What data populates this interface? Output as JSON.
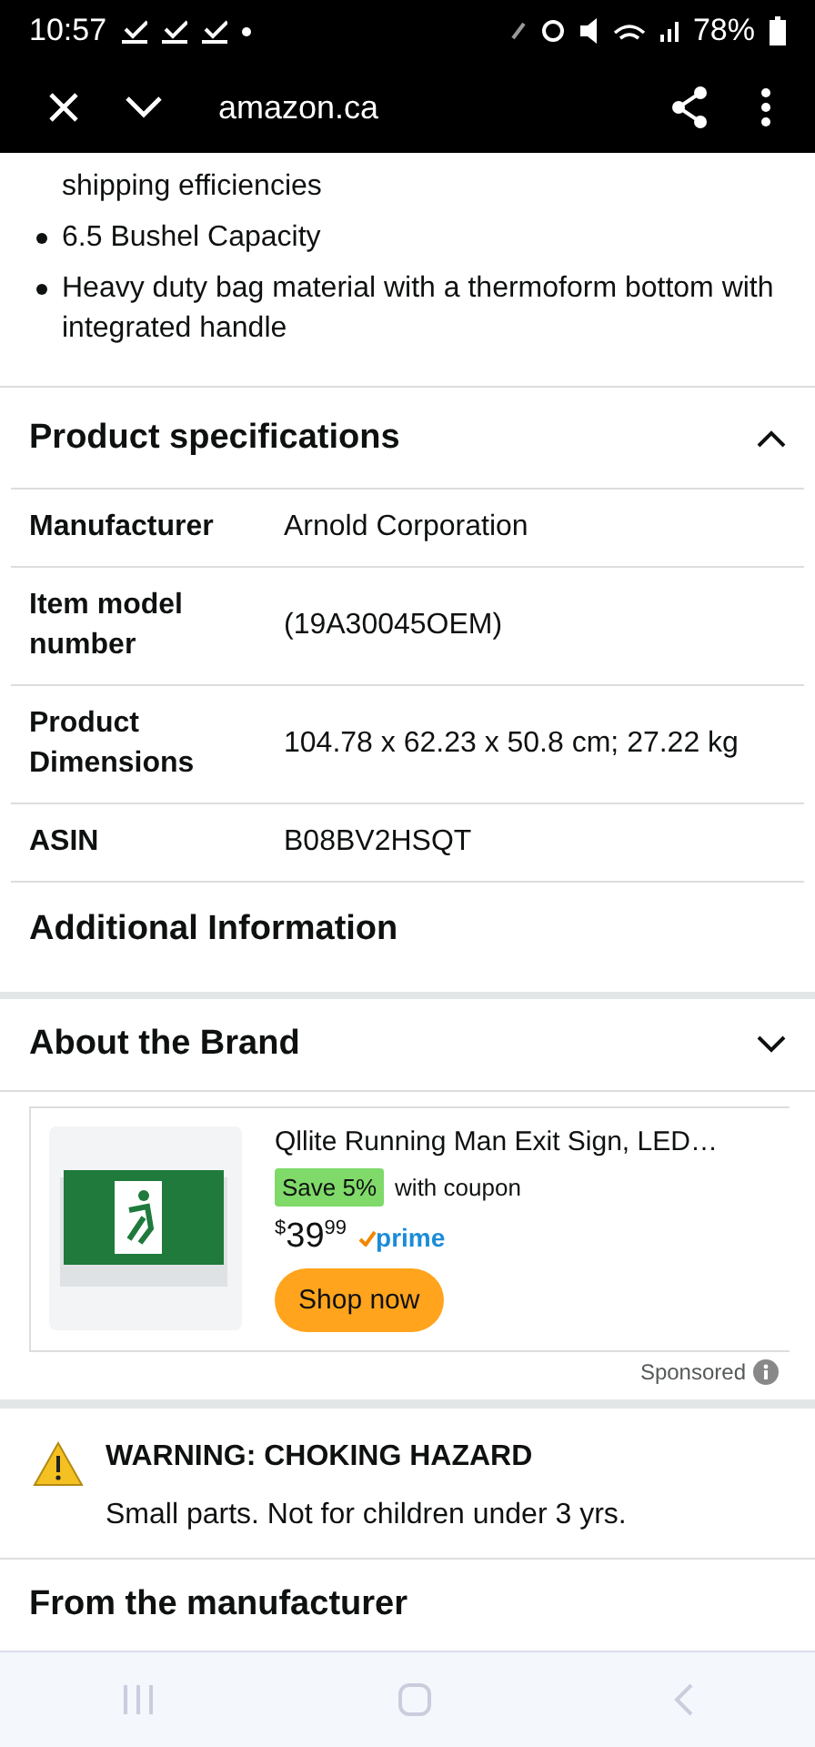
{
  "status_bar": {
    "time": "10:57",
    "battery": "78%"
  },
  "browser_bar": {
    "url": "amazon.ca"
  },
  "bullets": [
    {
      "text": "shipping efficiencies",
      "bullet": false
    },
    {
      "text": "6.5 Bushel Capacity",
      "bullet": true
    },
    {
      "text": "Heavy duty bag material with a thermoform bottom with integrated handle",
      "bullet": true
    }
  ],
  "product_specifications": {
    "title": "Product specifications",
    "expanded": true,
    "rows": [
      {
        "label": "Manufacturer",
        "value": "Arnold Corporation"
      },
      {
        "label": "Item model number",
        "value": "(19A30045OEM)"
      },
      {
        "label": "Product Dimensions",
        "value": "104.78 x 62.23 x 50.8 cm; 27.22 kg"
      },
      {
        "label": "ASIN",
        "value": "B08BV2HSQT"
      }
    ]
  },
  "additional_information": {
    "title": "Additional Information"
  },
  "about_the_brand": {
    "title": "About the Brand",
    "expanded": false
  },
  "ad": {
    "title": "Qllite Running Man Exit Sign, LED…",
    "badge": "Save 5%",
    "coupon": "with coupon",
    "currency": "$",
    "price_whole": "39",
    "price_fraction": "99",
    "prime": "prime",
    "button": "Shop now",
    "sponsored": "Sponsored"
  },
  "warning": {
    "title": "WARNING: CHOKING HAZARD",
    "text": "Small parts. Not for children under 3 yrs."
  },
  "from_manufacturer": {
    "title": "From the manufacturer"
  }
}
